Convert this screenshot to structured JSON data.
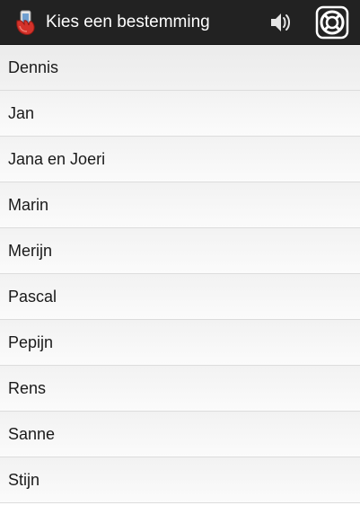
{
  "action_bar": {
    "title": "Kies een bestemming",
    "app_icon": "hand-holding-phone-icon",
    "actions": [
      {
        "icon": "speaker-volume-icon"
      },
      {
        "icon": "lifebuoy-help-icon"
      }
    ]
  },
  "destinations": [
    {
      "label": "Dennis"
    },
    {
      "label": "Jan"
    },
    {
      "label": "Jana en Joeri"
    },
    {
      "label": "Marin"
    },
    {
      "label": "Merijn"
    },
    {
      "label": "Pascal"
    },
    {
      "label": "Pepijn"
    },
    {
      "label": "Rens"
    },
    {
      "label": "Sanne"
    },
    {
      "label": "Stijn"
    }
  ],
  "colors": {
    "action_bar_bg": "#222222",
    "accent_red": "#d4322a"
  }
}
